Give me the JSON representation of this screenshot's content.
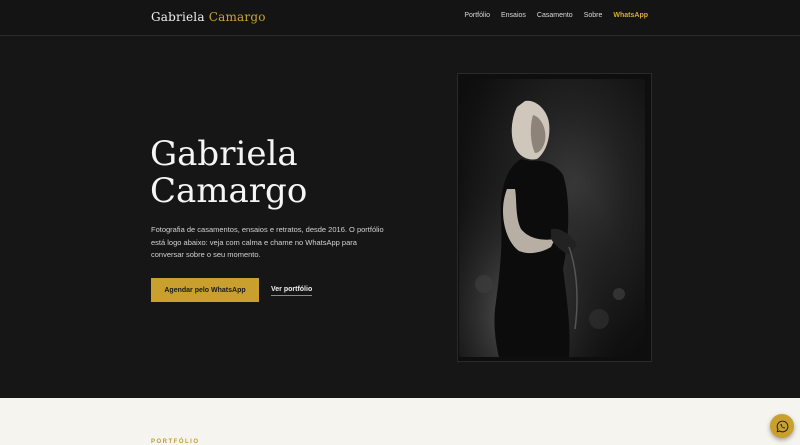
{
  "brand": {
    "first_name": "Gabriela",
    "last_name": "Camargo"
  },
  "nav": {
    "items": [
      "Portfólio",
      "Ensaios",
      "Casamento",
      "Sobre"
    ],
    "cta": "WhatsApp"
  },
  "hero": {
    "title_line1": "Gabriela",
    "title_line2": "Camargo",
    "description": "Fotografia de casamentos, ensaios e retratos, desde 2016. O portfólio está logo abaixo: veja com calma e chame no WhatsApp para conversar sobre o seu momento.",
    "primary_button": "Agendar pelo WhatsApp",
    "secondary_link": "Ver portfólio"
  },
  "portfolio": {
    "section_label": "PORTFÓLIO"
  },
  "colors": {
    "accent": "#c9a02d",
    "background": "#161616",
    "light_background": "#f6f4ef"
  },
  "icons": {
    "floating": "whatsapp-icon"
  }
}
